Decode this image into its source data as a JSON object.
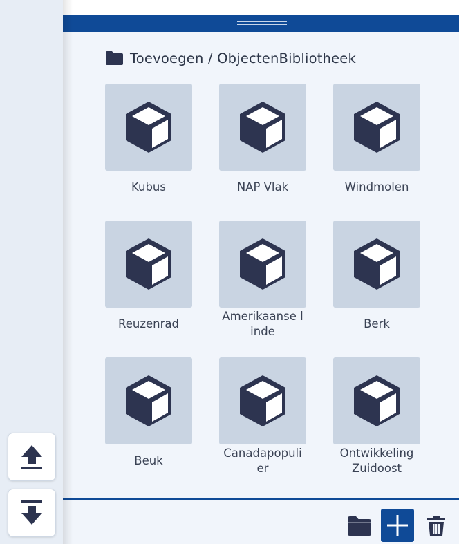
{
  "breadcrumb": {
    "path": "Toevoegen / ObjectenBibliotheek",
    "icon": "folder-icon"
  },
  "library": {
    "items": [
      {
        "label": "Kubus",
        "icon": "cube-icon"
      },
      {
        "label": "NAP Vlak",
        "icon": "cube-icon"
      },
      {
        "label": "Windmolen",
        "icon": "cube-icon"
      },
      {
        "label": "Reuzenrad",
        "icon": "cube-icon"
      },
      {
        "label": "Amerikaanse linde",
        "icon": "cube-icon"
      },
      {
        "label": "Berk",
        "icon": "cube-icon"
      },
      {
        "label": "Beuk",
        "icon": "cube-icon"
      },
      {
        "label": "Canadapopulier",
        "icon": "cube-icon"
      },
      {
        "label": "Ontwikkeling Zuidoost",
        "icon": "cube-icon"
      }
    ]
  },
  "toolbar": {
    "folder_icon": "folder-icon",
    "add_icon": "plus-icon",
    "delete_icon": "trash-icon"
  },
  "rail": {
    "upload_icon": "upload-icon",
    "download_icon": "download-icon"
  },
  "colors": {
    "accent": "#0f4a97",
    "tile_bg": "#c9d4e2",
    "icon_dark": "#2d3450",
    "panel_bg": "#f1f5fb",
    "rail_bg": "#e7edf5"
  }
}
